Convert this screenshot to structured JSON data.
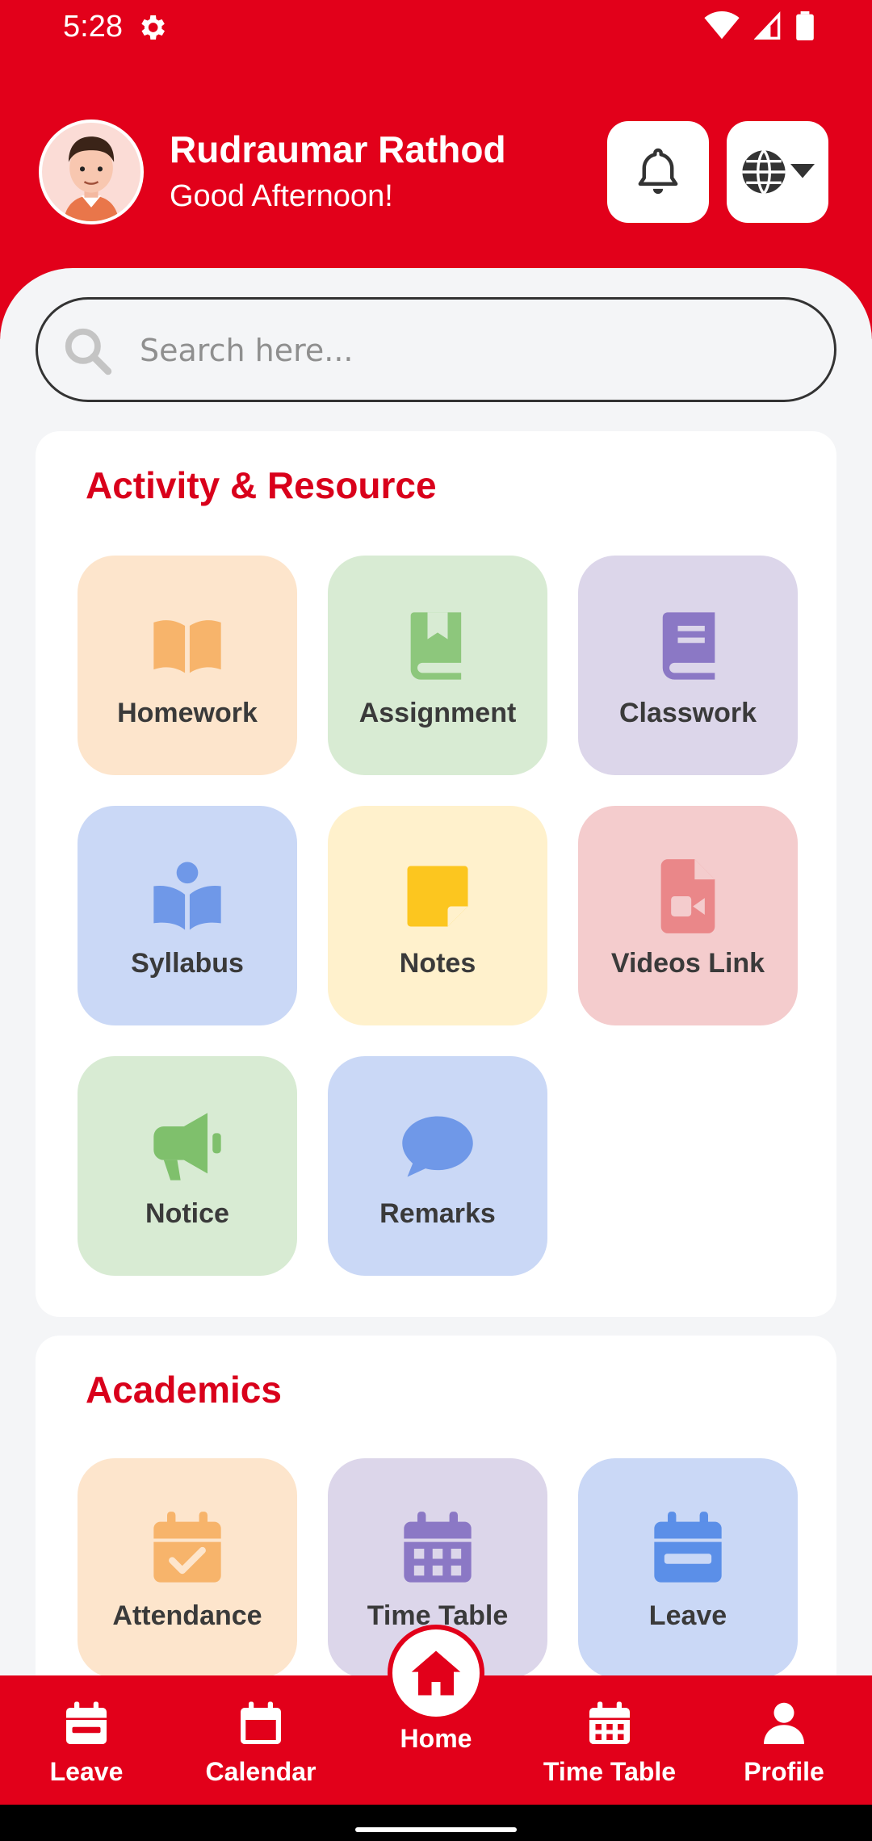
{
  "status_bar": {
    "time": "5:28"
  },
  "header": {
    "user_name": "Rudraumar Rathod",
    "greeting": "Good Afternoon!"
  },
  "search": {
    "placeholder": "Search here..."
  },
  "activity": {
    "title": "Activity & Resource",
    "tiles": [
      {
        "label": "Homework",
        "icon": "open-book-icon",
        "bg": "#fde5cc",
        "color": "#f7b46b"
      },
      {
        "label": "Assignment",
        "icon": "bookmark-book-icon",
        "bg": "#d8ebd3",
        "color": "#8dc77c"
      },
      {
        "label": "Classwork",
        "icon": "book-icon",
        "bg": "#dcd6ea",
        "color": "#8b78c5"
      },
      {
        "label": "Syllabus",
        "icon": "reader-icon",
        "bg": "#cad8f6",
        "color": "#6f98e8"
      },
      {
        "label": "Notes",
        "icon": "sticky-note-icon",
        "bg": "#fff1cc",
        "color": "#fcc61f"
      },
      {
        "label": "Videos Link",
        "icon": "video-file-icon",
        "bg": "#f4cccd",
        "color": "#ea8789"
      },
      {
        "label": "Notice",
        "icon": "megaphone-icon",
        "bg": "#d8ebd3",
        "color": "#7fc06c"
      },
      {
        "label": "Remarks",
        "icon": "chat-bubble-icon",
        "bg": "#cad8f6",
        "color": "#6f98e8"
      }
    ]
  },
  "academics": {
    "title": "Academics",
    "tiles": [
      {
        "label": "Attendance",
        "icon": "calendar-check-icon",
        "bg": "#fde5cc",
        "color": "#f7b46b"
      },
      {
        "label": "Time Table",
        "icon": "calendar-grid-icon",
        "bg": "#dcd6ea",
        "color": "#8b78c5"
      },
      {
        "label": "Leave",
        "icon": "calendar-minus-icon",
        "bg": "#cad8f6",
        "color": "#5b8fe8"
      }
    ]
  },
  "bottom_nav": {
    "items": [
      {
        "label": "Leave",
        "icon": "calendar-minus-icon"
      },
      {
        "label": "Calendar",
        "icon": "calendar-icon"
      },
      {
        "label": "Home",
        "icon": "home-icon"
      },
      {
        "label": "Time Table",
        "icon": "calendar-grid-icon"
      },
      {
        "label": "Profile",
        "icon": "user-icon"
      }
    ]
  },
  "colors": {
    "brand_red": "#e2001a",
    "title_red": "#d9001b",
    "background": "#f4f5f7"
  }
}
